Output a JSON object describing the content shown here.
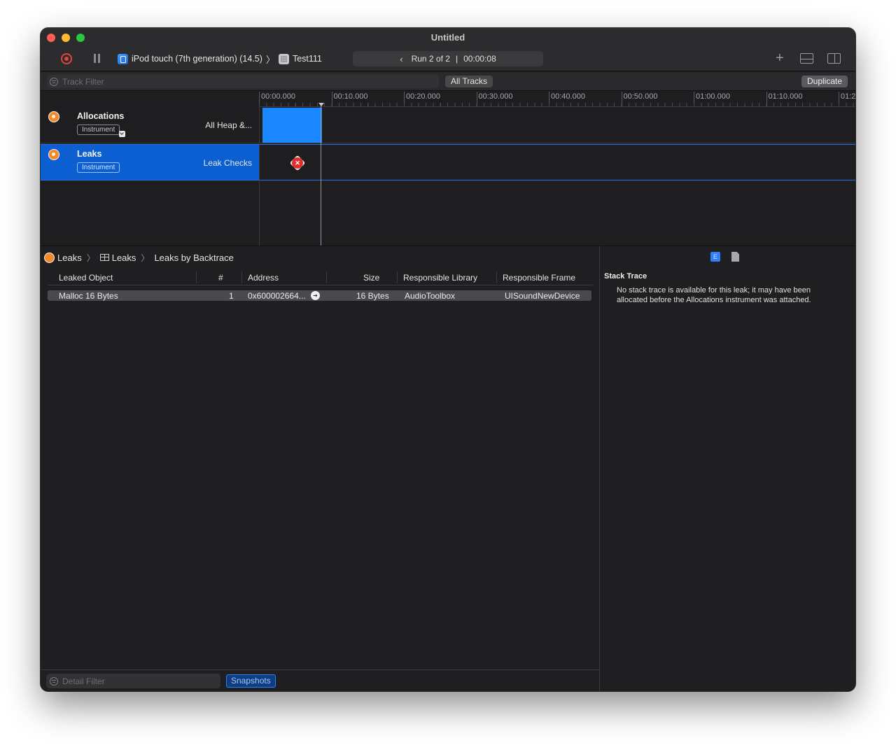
{
  "window": {
    "title": "Untitled"
  },
  "toolbar": {
    "device": "iPod touch (7th generation) (14.5)",
    "target": "Test111",
    "run_label": "Run 2 of 2",
    "run_separator": "|",
    "run_time": "00:00:08"
  },
  "filterbar": {
    "track_filter_placeholder": "Track Filter",
    "all_tracks": "All Tracks",
    "duplicate": "Duplicate"
  },
  "ruler": {
    "ticks": [
      "00:00.000",
      "00:10.000",
      "00:20.000",
      "00:30.000",
      "00:40.000",
      "00:50.000",
      "01:00.000",
      "01:10.000",
      "01:2"
    ]
  },
  "tracks": [
    {
      "name": "Allocations",
      "badge": "Instrument",
      "detail": "All Heap &..."
    },
    {
      "name": "Leaks",
      "badge": "Instrument",
      "detail": "Leak Checks"
    }
  ],
  "breadcrumb": {
    "item1": "Leaks",
    "item2": "Leaks",
    "item3": "Leaks by Backtrace"
  },
  "table": {
    "headers": [
      "Leaked Object",
      "#",
      "Address",
      "Size",
      "Responsible Library",
      "Responsible Frame"
    ],
    "rows": [
      {
        "object": "Malloc 16 Bytes",
        "count": "1",
        "address": "0x600002664...",
        "size": "16 Bytes",
        "library": "AudioToolbox",
        "frame": "UISoundNewDevice"
      }
    ]
  },
  "detail_footer": {
    "filter_placeholder": "Detail Filter",
    "snapshots": "Snapshots"
  },
  "inspector": {
    "title": "Stack Trace",
    "message": "No stack trace is available for this leak; it may have been allocated before the Allocations instrument was attached."
  },
  "colors": {
    "accent": "#0b5fd0",
    "allocation_bar": "#1a86ff",
    "leak_marker": "#e0302a",
    "record": "#e0443e"
  }
}
